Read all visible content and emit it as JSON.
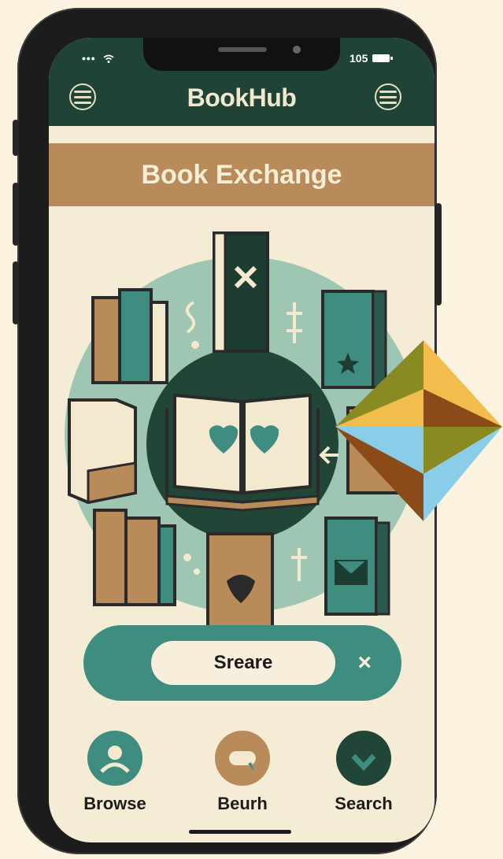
{
  "status_bar": {
    "signal": "•••",
    "time": "105"
  },
  "header": {
    "title": "BookHub"
  },
  "banner": {
    "title": "Book Exchange"
  },
  "action_bar": {
    "label": "Sreare",
    "close_symbol": "×"
  },
  "bottom_nav": [
    {
      "label": "Browse"
    },
    {
      "label": "Beurh"
    },
    {
      "label": "Search"
    }
  ],
  "colors": {
    "header_bg": "#1f4336",
    "banner_bg": "#b98a5a",
    "accent_teal": "#3f8d80",
    "screen_bg": "#f5ecd6",
    "page_bg": "#fbf3df"
  },
  "icons": [
    "menu-icon",
    "wifi-icon",
    "battery-icon",
    "book-icon",
    "heart-icon",
    "user-icon",
    "chat-icon",
    "check-icon",
    "close-icon",
    "arrow-left-icon"
  ]
}
